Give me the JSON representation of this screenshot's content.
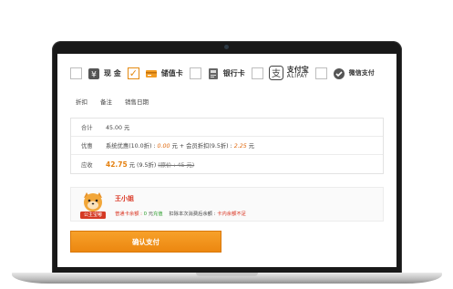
{
  "payment_methods": [
    {
      "label": "现 金",
      "checked": false,
      "icon": "cash-icon"
    },
    {
      "label": "储值卡",
      "checked": true,
      "icon": "stored-value-card-icon"
    },
    {
      "label": "银行卡",
      "checked": false,
      "icon": "bank-card-icon"
    },
    {
      "label": "支付宝",
      "sublabel": "ALIPAY",
      "checked": false,
      "icon": "alipay-icon"
    },
    {
      "label": "微信支付",
      "checked": false,
      "icon": "wechat-pay-icon"
    }
  ],
  "tabs": [
    "折扣",
    "备注",
    "销售日期"
  ],
  "amounts": {
    "total": {
      "label": "合计",
      "value": "45.00 元"
    },
    "discount": {
      "label": "优惠",
      "system_prefix": "系统优惠(10.0折) : ",
      "system_value": "0.00",
      "unit": " 元",
      "member_prefix": " + 会员折扣(9.5折) : ",
      "member_value": "2.25"
    },
    "receivable": {
      "label": "应收",
      "value": "42.75",
      "unit": " 元",
      "discount_note": " (9.5折) ",
      "original": "(原价 : 45 元)"
    }
  },
  "member": {
    "name": "王小姐",
    "avatar_text": "公主宝嘟",
    "balance_label": "普通卡余额 : ",
    "balance_value": "0",
    "balance_unit": " 元",
    "balance_state": "充值",
    "after_label": "扣除本次消费后余额 : ",
    "after_value": "卡内余额不足"
  },
  "confirm_label": "确认支付",
  "colors": {
    "accent": "#ec8710",
    "red": "#d9321f",
    "green": "#2b9d2b"
  }
}
